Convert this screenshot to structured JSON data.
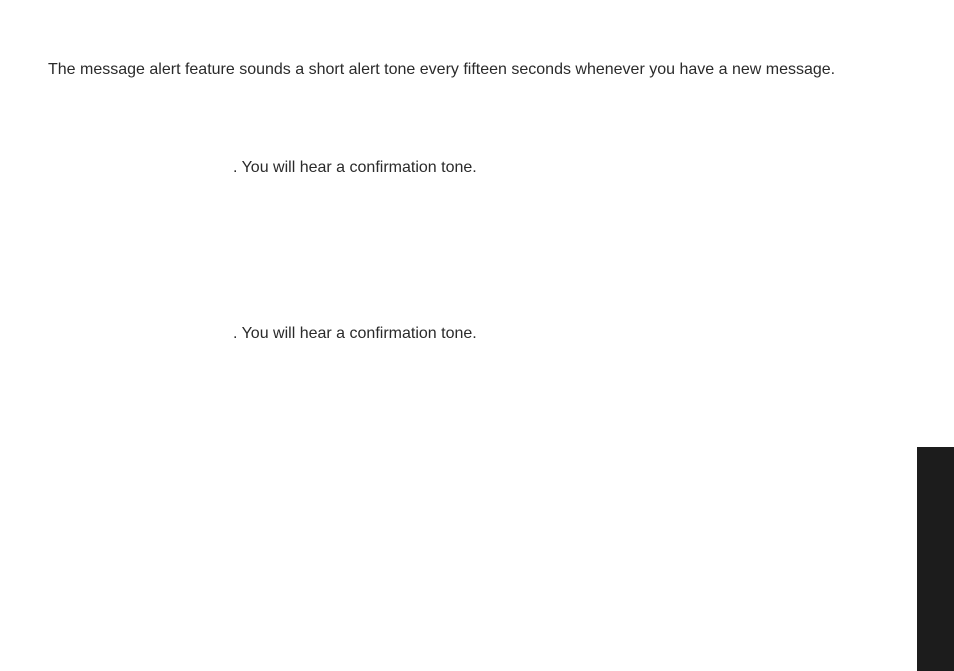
{
  "document": {
    "intro": "The message alert feature sounds a short alert tone every fifteen seconds whenever you have a new message.",
    "steps": [
      ". You will hear a confirmation tone.",
      ". You will hear a confirmation tone."
    ]
  }
}
